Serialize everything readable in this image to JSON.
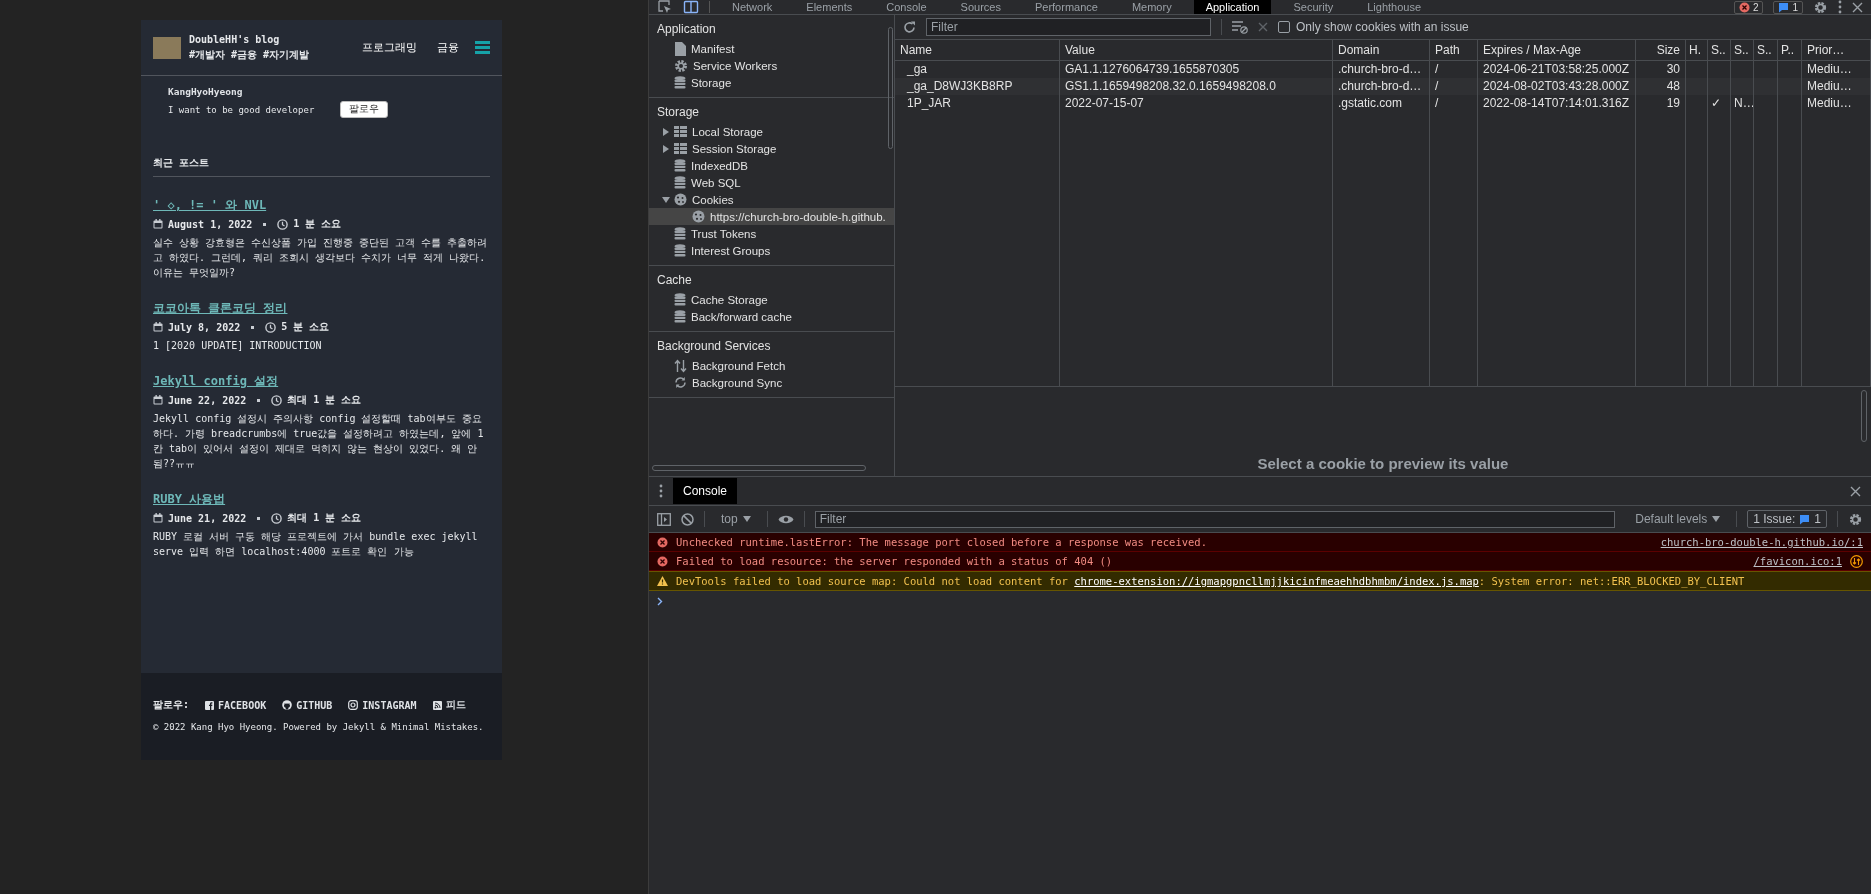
{
  "blog": {
    "title": "DoubleHH's blog",
    "tagline": "#개발자 #금융 #자기계발",
    "nav": [
      "프로그래밍",
      "금융"
    ],
    "author": {
      "name": "KangHyoHyeong",
      "bio": "I want to be good developer",
      "follow_button": "팔로우"
    },
    "section_title": "최근 포스트",
    "posts": [
      {
        "title": "' ◇, != ' 와 NVL",
        "date": "August 1, 2022",
        "read_time": "1 분 소요",
        "excerpt": "실수 상황 강효형은 수신상품 가입 진행중 중단된 고객 수를 추출하려고 하였다. 그런데, 쿼리 조회시 생각보다 수치가 너무 적게 나왔다. 이유는 무엇일까?"
      },
      {
        "title": "코코아톡 클론코딩 정리",
        "date": "July 8, 2022",
        "read_time": "5 분 소요",
        "excerpt": "1 [2020 UPDATE] INTRODUCTION"
      },
      {
        "title": "Jekyll config 설정",
        "date": "June 22, 2022",
        "read_time": "최대 1 분 소요",
        "excerpt": "Jekyll config 설정시 주의사항 config 설정할때 tab여부도 중요하다. 가령 breadcrumbs에 true값을 설정하려고 하였는데, 앞에 1칸 tab이 있어서 설정이 제대로 먹히지 않는 현상이 있었다. 왜 안됨??ㅠㅠ"
      },
      {
        "title": "RUBY 사용법",
        "date": "June 21, 2022",
        "read_time": "최대 1 분 소요",
        "excerpt": "RUBY 로컬 서버 구동 해당 프로젝트에 가서 bundle exec jekyll serve 입력 하면 localhost:4000 포트로 확인 가능"
      }
    ],
    "footer": {
      "follow_label": "팔로우:",
      "links": [
        {
          "kind": "facebook",
          "label": "FACEBOOK"
        },
        {
          "kind": "github",
          "label": "GITHUB"
        },
        {
          "kind": "instagram",
          "label": "INSTAGRAM"
        },
        {
          "kind": "feed",
          "label": "피드"
        }
      ],
      "copyright": "© 2022 Kang Hyo Hyeong. Powered by Jekyll & Minimal Mistakes."
    }
  },
  "devtools": {
    "tabs": [
      {
        "label": "Network",
        "selected": false
      },
      {
        "label": "Elements",
        "selected": false
      },
      {
        "label": "Console",
        "selected": false
      },
      {
        "label": "Sources",
        "selected": false
      },
      {
        "label": "Performance",
        "selected": false
      },
      {
        "label": "Memory",
        "selected": false
      },
      {
        "label": "Application",
        "selected": true
      },
      {
        "label": "Security",
        "selected": false
      },
      {
        "label": "Lighthouse",
        "selected": false
      }
    ],
    "error_count": "2",
    "issue_count": "1",
    "sidebar": [
      {
        "heading": "Application",
        "items": [
          {
            "kind": "file",
            "label": "Manifest",
            "selected": false
          },
          {
            "kind": "gear",
            "label": "Service Workers",
            "selected": false
          },
          {
            "kind": "database",
            "label": "Storage",
            "selected": false
          }
        ]
      },
      {
        "heading": "Storage",
        "items": [
          {
            "kind": "grid",
            "label": "Local Storage",
            "expanded": false,
            "selected": false
          },
          {
            "kind": "grid",
            "label": "Session Storage",
            "expanded": false,
            "selected": false
          },
          {
            "kind": "database",
            "label": "IndexedDB",
            "selected": false
          },
          {
            "kind": "database",
            "label": "Web SQL",
            "selected": false
          },
          {
            "kind": "cookie",
            "label": "Cookies",
            "expanded": true,
            "selected": false,
            "children": [
              {
                "kind": "cookie",
                "label": "https://church-bro-double-h.github.",
                "selected": true
              }
            ]
          },
          {
            "kind": "database",
            "label": "Trust Tokens",
            "selected": false
          },
          {
            "kind": "database",
            "label": "Interest Groups",
            "selected": false
          }
        ]
      },
      {
        "heading": "Cache",
        "items": [
          {
            "kind": "database",
            "label": "Cache Storage",
            "selected": false
          },
          {
            "kind": "database",
            "label": "Back/forward cache",
            "selected": false
          }
        ]
      },
      {
        "heading": "Background Services",
        "items": [
          {
            "kind": "updown",
            "label": "Background Fetch",
            "selected": false
          },
          {
            "kind": "sync",
            "label": "Background Sync",
            "selected": false
          }
        ]
      }
    ],
    "cookies": {
      "filter": {
        "placeholder": "Filter"
      },
      "issue_only": {
        "label": "Only show cookies with an issue",
        "checked": false
      },
      "columns": [
        "Name",
        "Value",
        "Domain",
        "Path",
        "Expires / Max-Age",
        "Size",
        "H.",
        "S..",
        "S..",
        "S..",
        "P..",
        "Prior…"
      ],
      "rows": [
        {
          "cells": [
            "_ga",
            "GA1.1.1276064739.1655870305",
            ".church-bro-d…",
            "/",
            "2024-06-21T03:58:25.000Z",
            "30",
            null,
            null,
            null,
            null,
            null,
            "Mediu…"
          ]
        },
        {
          "cells": [
            "_ga_D8WJ3KB8RP",
            "GS1.1.1659498208.32.0.1659498208.0",
            ".church-bro-d…",
            "/",
            "2024-08-02T03:43:28.000Z",
            "48",
            null,
            null,
            null,
            null,
            null,
            "Mediu…"
          ]
        },
        {
          "cells": [
            "1P_JAR",
            "2022-07-15-07",
            ".gstatic.com",
            "/",
            "2022-08-14T07:14:01.316Z",
            "19",
            null,
            "✓",
            "N…",
            null,
            null,
            "Mediu…"
          ]
        }
      ],
      "preview_hint": "Select a cookie to preview its value"
    },
    "console": {
      "tab": "Console",
      "context": "top",
      "filter": {
        "placeholder": "Filter"
      },
      "levels": "Default levels",
      "issues_label": "1 Issue:",
      "issues_count": "1",
      "messages": [
        {
          "kind": "error",
          "text": "Unchecked runtime.lastError: The message port closed before a response was received.",
          "source": "church-bro-double-h.github.io/:1",
          "network_badge": false
        },
        {
          "kind": "error",
          "text": "Failed to load resource: the server responded with a status of 404 ()",
          "source": "/favicon.ico:1",
          "network_badge": true
        },
        {
          "kind": "warning",
          "text": "DevTools failed to load source map: Could not load content for ",
          "link": "chrome-extension://igmapgpncllmjjkicinfmeaehhdbhmbm/index.js.map",
          "text_after": ": System error: net::ERR_BLOCKED_BY_CLIENT",
          "network_badge": false
        }
      ]
    }
  }
}
